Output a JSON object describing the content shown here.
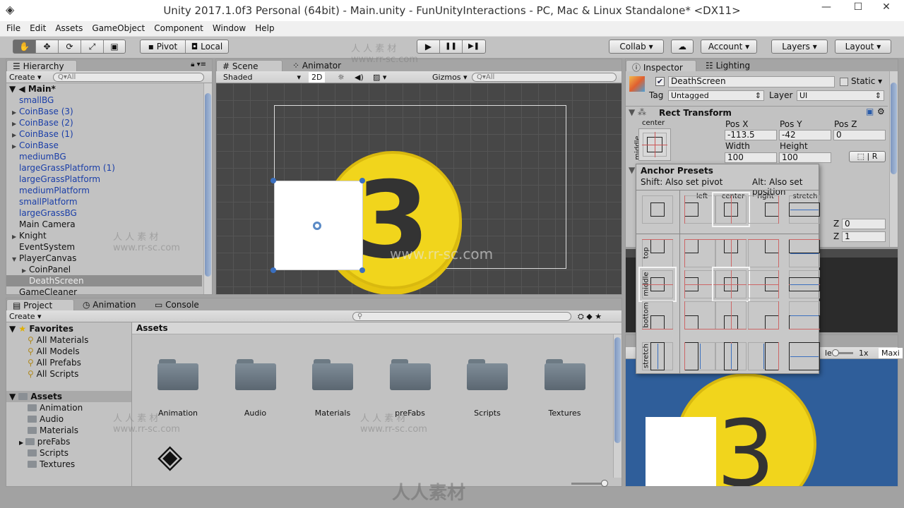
{
  "window": {
    "title": "Unity 2017.1.0f3 Personal (64bit) - Main.unity - FunUnityInteractions - PC, Mac & Linux Standalone* <DX11>",
    "minimize": "—",
    "maximize": "☐",
    "close": "✕"
  },
  "menu": [
    "File",
    "Edit",
    "Assets",
    "GameObject",
    "Component",
    "Window",
    "Help"
  ],
  "toolbar": {
    "tools": [
      "hand-tool",
      "move-tool",
      "rotate-tool",
      "scale-tool",
      "rect-tool"
    ],
    "tool_glyphs": [
      "✋",
      "✥",
      "⟳",
      "⤢",
      "▣"
    ],
    "pivot": "Pivot",
    "local": "Local",
    "play": "▶",
    "pause": "❚❚",
    "step": "▶❚",
    "collab": "Collab ▾",
    "cloud": "☁",
    "account": "Account",
    "layers": "Layers",
    "layout": "Layout"
  },
  "hierarchy": {
    "tab": "Hierarchy",
    "create": "Create",
    "search_placeholder": "Q▾All",
    "scene": "Main*",
    "items": [
      {
        "label": "smallBG",
        "indent": 1,
        "arrow": "",
        "style": "blue"
      },
      {
        "label": "CoinBase (3)",
        "indent": 1,
        "arrow": "▶",
        "style": "blue"
      },
      {
        "label": "CoinBase (2)",
        "indent": 1,
        "arrow": "▶",
        "style": "blue"
      },
      {
        "label": "CoinBase (1)",
        "indent": 1,
        "arrow": "▶",
        "style": "blue"
      },
      {
        "label": "CoinBase",
        "indent": 1,
        "arrow": "▶",
        "style": "blue"
      },
      {
        "label": "mediumBG",
        "indent": 1,
        "arrow": "",
        "style": "blue"
      },
      {
        "label": "largeGrassPlatform (1)",
        "indent": 1,
        "arrow": "",
        "style": "blue"
      },
      {
        "label": "largeGrassPlatform",
        "indent": 1,
        "arrow": "",
        "style": "blue"
      },
      {
        "label": "mediumPlatform",
        "indent": 1,
        "arrow": "",
        "style": "blue"
      },
      {
        "label": "smallPlatform",
        "indent": 1,
        "arrow": "",
        "style": "blue"
      },
      {
        "label": "largeGrassBG",
        "indent": 1,
        "arrow": "",
        "style": "blue"
      },
      {
        "label": "Main Camera",
        "indent": 1,
        "arrow": "",
        "style": "black"
      },
      {
        "label": "Knight",
        "indent": 1,
        "arrow": "▶",
        "style": "black"
      },
      {
        "label": "EventSystem",
        "indent": 1,
        "arrow": "",
        "style": "black"
      },
      {
        "label": "PlayerCanvas",
        "indent": 1,
        "arrow": "▼",
        "style": "black"
      },
      {
        "label": "CoinPanel",
        "indent": 2,
        "arrow": "▶",
        "style": "black"
      },
      {
        "label": "DeathScreen",
        "indent": 2,
        "arrow": "",
        "style": "selected"
      },
      {
        "label": "GameCleaner",
        "indent": 1,
        "arrow": "",
        "style": "black"
      }
    ]
  },
  "scene": {
    "tab": "Scene",
    "animator_tab": "Animator",
    "shading": "Shaded",
    "mode_2d": "2D",
    "gizmos": "Gizmos",
    "search_placeholder": "Q▾All",
    "coin_number": "3"
  },
  "project": {
    "tabs": [
      "Project",
      "Animation",
      "Console"
    ],
    "create": "Create",
    "favorites": {
      "label": "Favorites",
      "items": [
        "All Materials",
        "All Models",
        "All Prefabs",
        "All Scripts"
      ]
    },
    "assets_root": "Assets",
    "tree": [
      "Animation",
      "Audio",
      "Materials",
      "preFabs",
      "Scripts",
      "Textures"
    ],
    "breadcrumb": "Assets",
    "folders": [
      "Animation",
      "Audio",
      "Materials",
      "preFabs",
      "Scripts",
      "Textures"
    ]
  },
  "inspector": {
    "tab": "Inspector",
    "lighting_tab": "Lighting",
    "object_name": "DeathScreen",
    "active": true,
    "static_label": "Static",
    "tag_label": "Tag",
    "tag_value": "Untagged",
    "layer_label": "Layer",
    "layer_value": "UI",
    "rect_transform": {
      "title": "Rect Transform",
      "anchor_h": "center",
      "anchor_v": "middle",
      "pos_x_label": "Pos X",
      "pos_y_label": "Pos Y",
      "pos_z_label": "Pos Z",
      "pos_x": "-113.5",
      "pos_y": "-42",
      "pos_z": "0",
      "width_label": "Width",
      "height_label": "Height",
      "width": "100",
      "height": "100",
      "raw_button": "R",
      "z_label": "Z",
      "z1": "0",
      "z2": "1"
    }
  },
  "anchor_presets": {
    "title": "Anchor Presets",
    "shift_hint": "Shift: Also set pivot",
    "alt_hint": "Alt: Also set position",
    "columns": [
      "left",
      "center",
      "right",
      "stretch"
    ],
    "rows": [
      "top",
      "middle",
      "bottom",
      "stretch"
    ],
    "selected": [
      "center",
      "middle"
    ]
  },
  "game": {
    "scale_label": "le",
    "scale_value": "1x",
    "maximize": "Maxi",
    "coin_number": "3"
  },
  "colors": {
    "accent_blue": "#3a6fbf",
    "coin_yellow": "#f1d51c",
    "scene_bg": "#474747",
    "game_bg": "#2f5e9a"
  },
  "watermark": {
    "cn": "人 人 素 材",
    "url": "www.rr-sc.com",
    "logo": "人人素材"
  }
}
